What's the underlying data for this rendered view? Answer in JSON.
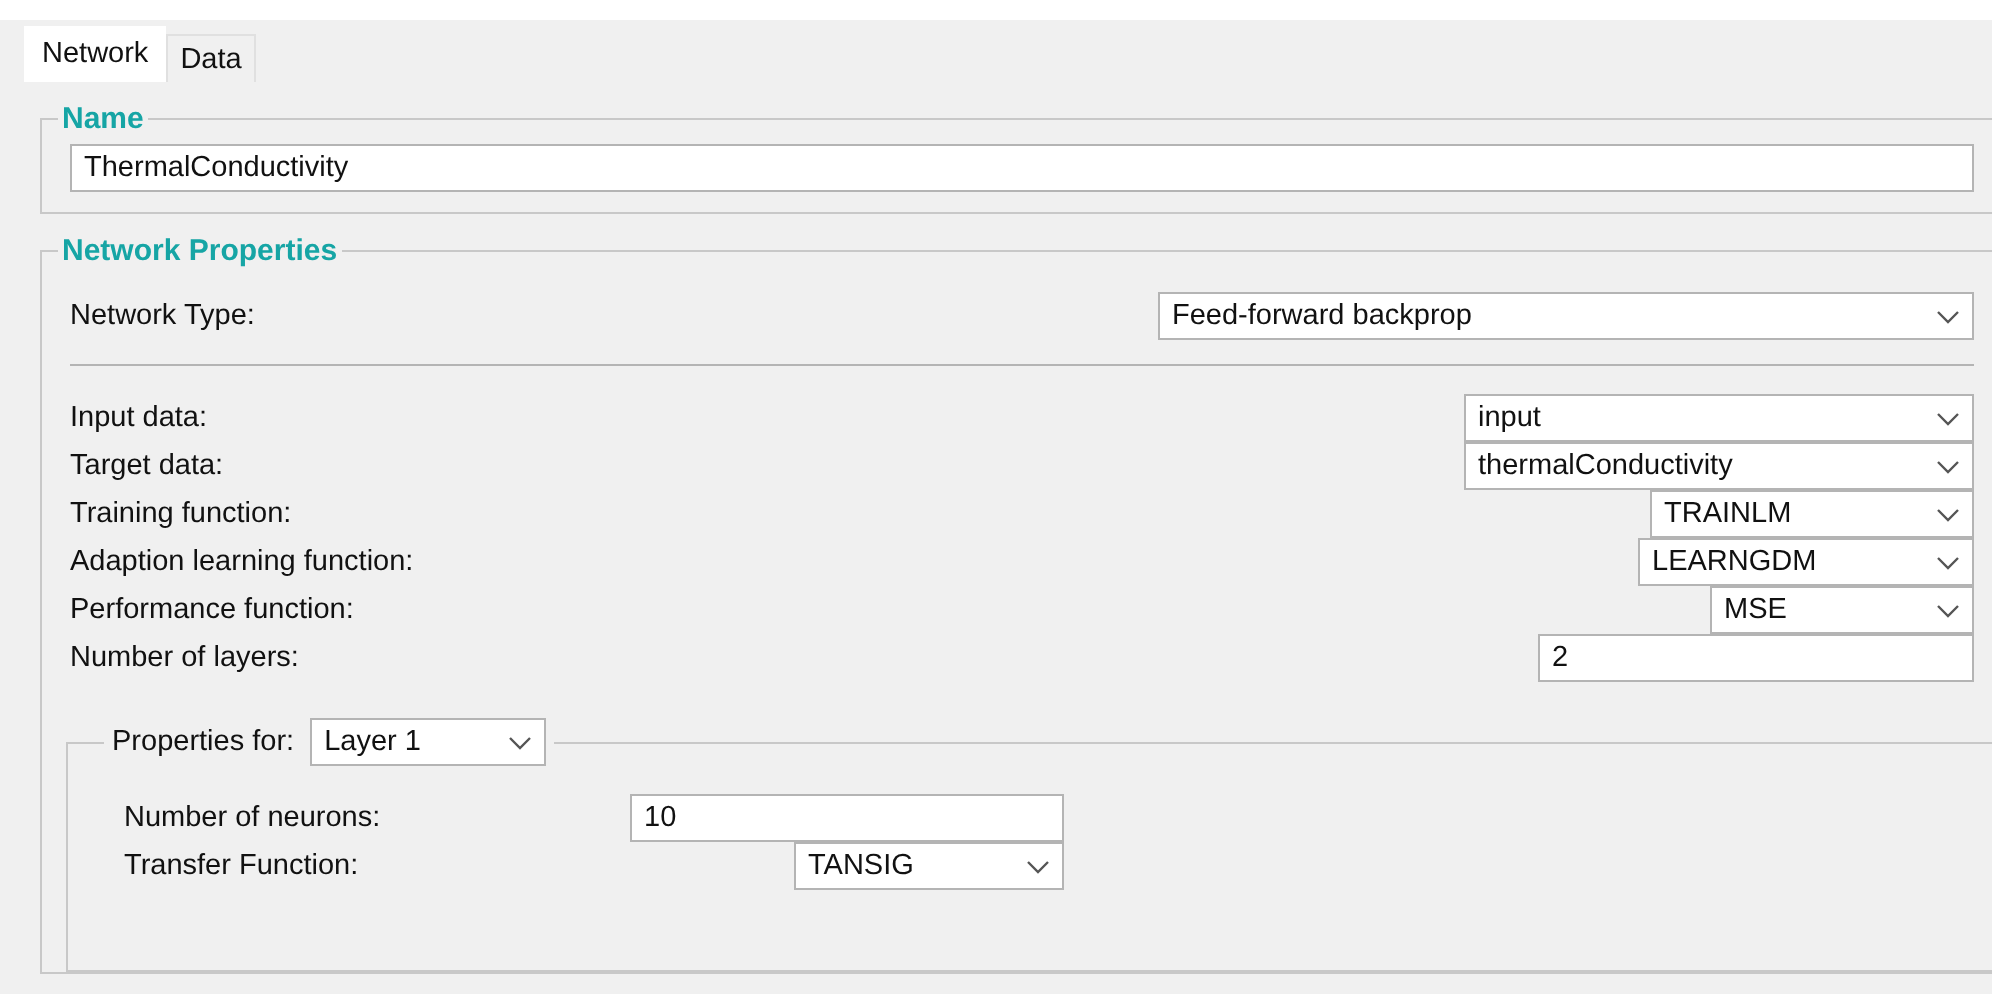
{
  "tabs": [
    {
      "label": "Network",
      "selected": true
    },
    {
      "label": "Data",
      "selected": false
    }
  ],
  "name_group": {
    "title": "Name",
    "value": "ThermalConductivity"
  },
  "network_properties": {
    "title": "Network Properties",
    "network_type": {
      "label": "Network Type:",
      "value": "Feed-forward backprop"
    },
    "fields": [
      {
        "kind": "select",
        "label": "Input data:",
        "value": "input"
      },
      {
        "kind": "select",
        "label": "Target data:",
        "value": "thermalConductivity"
      },
      {
        "kind": "select",
        "label": "Training function:",
        "value": "TRAINLM"
      },
      {
        "kind": "select",
        "label": "Adaption learning function:",
        "value": "LEARNGDM"
      },
      {
        "kind": "select",
        "label": "Performance function:",
        "value": "MSE"
      },
      {
        "kind": "input",
        "label": "Number of layers:",
        "value": "2"
      }
    ],
    "layer": {
      "label": "Properties for:",
      "value": "Layer 1",
      "fields": [
        {
          "kind": "input",
          "label": "Number of neurons:",
          "value": "10"
        },
        {
          "kind": "select",
          "label": "Transfer Function:",
          "value": "TANSIG"
        }
      ]
    }
  }
}
